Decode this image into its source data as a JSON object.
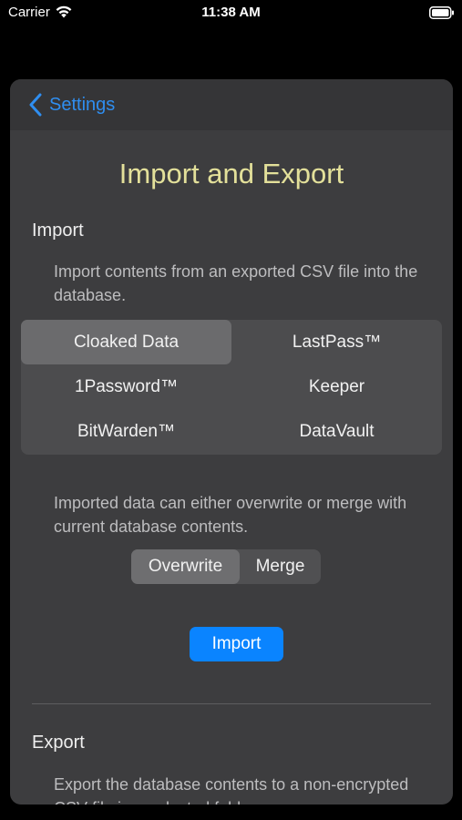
{
  "status_bar": {
    "carrier": "Carrier",
    "time": "11:38 AM"
  },
  "nav": {
    "back_label": "Settings"
  },
  "title": "Import and Export",
  "import_section": {
    "heading": "Import",
    "description": "Import contents from an exported CSV file into the database.",
    "sources": [
      {
        "label": "Cloaked Data",
        "selected": true
      },
      {
        "label": "LastPass™",
        "selected": false
      },
      {
        "label": "1Password™",
        "selected": false
      },
      {
        "label": "Keeper",
        "selected": false
      },
      {
        "label": "BitWarden™",
        "selected": false
      },
      {
        "label": "DataVault",
        "selected": false
      }
    ],
    "mode_description": "Imported data can either overwrite or merge with current database contents.",
    "modes": [
      {
        "label": "Overwrite",
        "selected": true
      },
      {
        "label": "Merge",
        "selected": false
      }
    ],
    "import_button": "Import"
  },
  "export_section": {
    "heading": "Export",
    "description": "Export the database contents to a non-encrypted CSV file in a selected folder."
  },
  "colors": {
    "accent": "#0a84ff",
    "back_link": "#2f8ef0",
    "title": "#e3e09a",
    "sheet_background": "#3d3d3f"
  }
}
